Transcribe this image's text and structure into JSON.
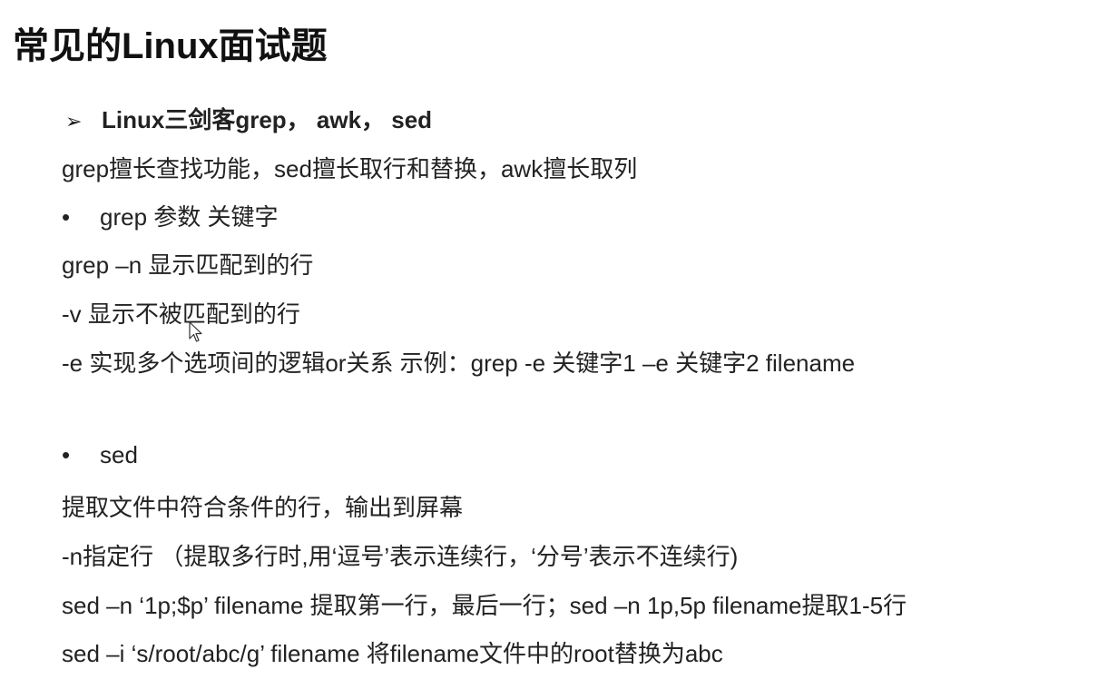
{
  "slide": {
    "title": "常见的Linux面试题",
    "heading": {
      "bullet": "➢",
      "text": "Linux三剑客grep， awk， sed"
    },
    "summary": "grep擅长查找功能，sed擅长取行和替换，awk擅长取列",
    "grep_section": {
      "bullet": "•",
      "title": "grep  参数  关键字",
      "lines": [
        "grep –n  显示匹配到的行",
        " -v 显示不被匹配到的行",
        " -e 实现多个选项间的逻辑or关系     示例：grep  -e 关键字1 –e 关键字2  filename"
      ]
    },
    "sed_section": {
      "bullet": "•",
      "title": "sed",
      "lines": [
        "提取文件中符合条件的行，输出到屏幕",
        "-n指定行 （提取多行时,用‘逗号’表示连续行，‘分号’表示不连续行)",
        " sed –n ‘1p;$p’ filename  提取第一行，最后一行；sed –n 1p,5p filename提取1-5行",
        " sed –i ‘s/root/abc/g’ filename 将filename文件中的root替换为abc"
      ]
    },
    "icons": {
      "cursor": "mouse-pointer-icon"
    }
  }
}
